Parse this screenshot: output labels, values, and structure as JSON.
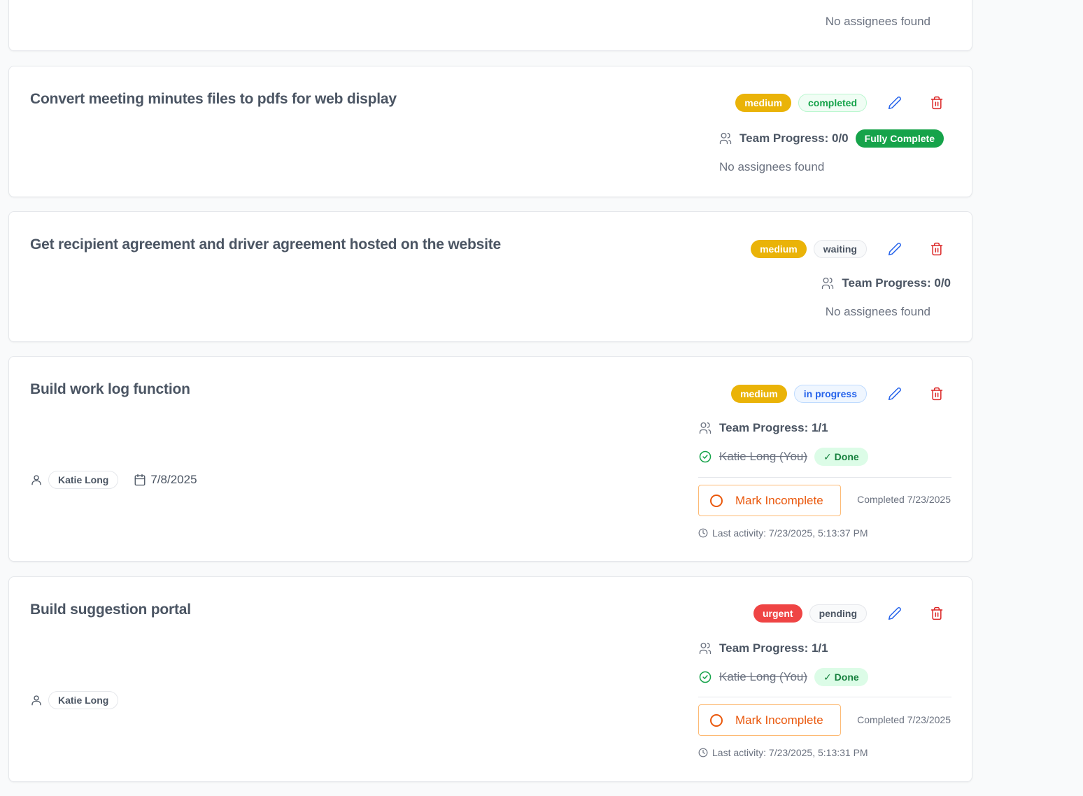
{
  "tasks": [
    {
      "no_assignees": "No assignees found"
    },
    {
      "title": "Convert meeting minutes files to pdfs for web display",
      "priority": "medium",
      "status": "completed",
      "team_progress": "Team Progress: 0/0",
      "fully_complete": "Fully Complete",
      "no_assignees": "No assignees found"
    },
    {
      "title": "Get recipient agreement and driver agreement hosted on the website",
      "priority": "medium",
      "status": "waiting",
      "team_progress": "Team Progress: 0/0",
      "no_assignees": "No assignees found"
    },
    {
      "title": "Build work log function",
      "priority": "medium",
      "status": "in progress",
      "team_progress": "Team Progress: 1/1",
      "assignee": "Katie Long (You)",
      "done_label": "✓ Done",
      "mark_incomplete": "Mark Incomplete",
      "completed_date": "Completed 7/23/2025",
      "last_activity": "Last activity: 7/23/2025, 5:13:37 PM",
      "user_chip": "Katie Long",
      "due_date": "7/8/2025"
    },
    {
      "title": "Build suggestion portal",
      "priority": "urgent",
      "status": "pending",
      "team_progress": "Team Progress: 1/1",
      "assignee": "Katie Long (You)",
      "done_label": "✓ Done",
      "mark_incomplete": "Mark Incomplete",
      "completed_date": "Completed 7/23/2025",
      "last_activity": "Last activity: 7/23/2025, 5:13:31 PM",
      "user_chip": "Katie Long"
    }
  ],
  "icons": {
    "edit": "pencil-icon",
    "delete": "trash-icon",
    "team": "users-icon",
    "check": "check-circle-icon",
    "clock": "clock-icon",
    "user": "user-icon",
    "calendar": "calendar-icon"
  },
  "colors": {
    "medium": "#eab308",
    "urgent": "#ef4444",
    "fully_complete": "#16a34a",
    "mark_incomplete": "#ea580c",
    "edit": "#2563eb",
    "delete": "#dc2626"
  }
}
